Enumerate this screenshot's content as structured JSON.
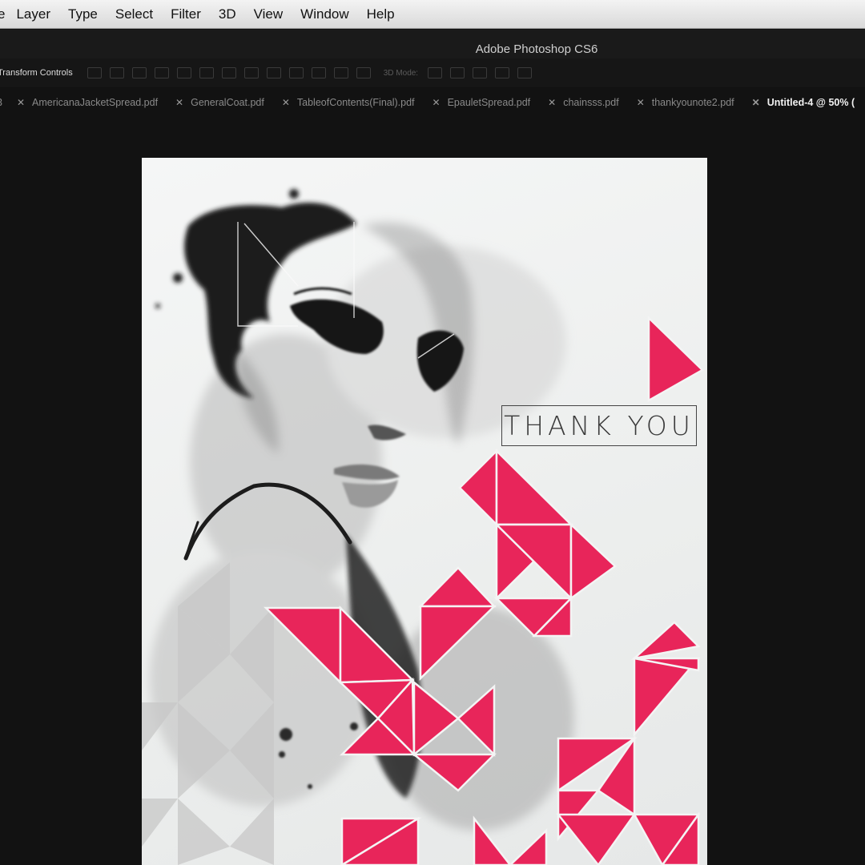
{
  "menubar": {
    "items": [
      "e",
      "Layer",
      "Type",
      "Select",
      "Filter",
      "3D",
      "View",
      "Window",
      "Help"
    ]
  },
  "titlebar": {
    "title": "Adobe Photoshop CS6"
  },
  "options": {
    "transform_label": "Transform Controls",
    "mode_label": "3D Mode:"
  },
  "tabs": {
    "first_fragment": "3",
    "items": [
      "AmericanaJacketSpread.pdf",
      "GeneralCoat.pdf",
      "TableofContents(Final).pdf",
      "EpauletSpread.pdf",
      "chainsss.pdf",
      "thankyounote2.pdf"
    ],
    "active": "Untitled-4 @ 50% ( "
  },
  "document": {
    "card_text": "THANK YOU",
    "accent_color": "#e8255a",
    "ink_color": "#1a1a1a"
  }
}
